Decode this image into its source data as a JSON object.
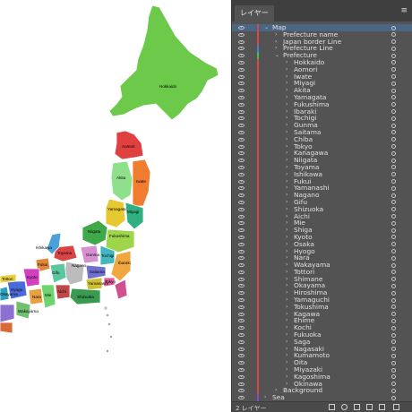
{
  "map": {
    "prefecture_labels": [
      {
        "text": "Hokkaido"
      },
      {
        "text": "Aomori"
      },
      {
        "text": "Akita"
      },
      {
        "text": "Iwate"
      },
      {
        "text": "Yamagata"
      },
      {
        "text": "Miyagi"
      },
      {
        "text": "Niigata"
      },
      {
        "text": "Fukushima"
      },
      {
        "text": "Ishikawa"
      },
      {
        "text": "Toyama"
      },
      {
        "text": "Gunma"
      },
      {
        "text": "Tochigi"
      },
      {
        "text": "Ibaraki"
      },
      {
        "text": "Saitama"
      },
      {
        "text": "Nagano"
      },
      {
        "text": "Yamanashi"
      },
      {
        "text": "Tokyo"
      },
      {
        "text": "Fukui"
      },
      {
        "text": "Gifu"
      },
      {
        "text": "Shizuoka"
      },
      {
        "text": "Aichi"
      },
      {
        "text": "Kyoto"
      },
      {
        "text": "Hyogo"
      },
      {
        "text": "Mie"
      },
      {
        "text": "Nara"
      },
      {
        "text": "Okayama"
      },
      {
        "text": "Tottori"
      },
      {
        "text": "Wakayama"
      }
    ]
  },
  "layers_panel": {
    "tab_label": "レイヤー",
    "menu_icon": "hamburger-menu-icon",
    "colors": {
      "red": "#d14b4b",
      "blue": "#4a7fd4",
      "green": "#3fbf4f",
      "purple": "#8050c8"
    },
    "rows": [
      {
        "name": "Map",
        "indent": 0,
        "expanded": true,
        "selected": true,
        "color": "red"
      },
      {
        "name": "Prefecture name",
        "indent": 1,
        "expanded": false,
        "color": "red"
      },
      {
        "name": "Japan border Line",
        "indent": 1,
        "expanded": false,
        "color": "red"
      },
      {
        "name": "Prefecture Line",
        "indent": 1,
        "expanded": false,
        "color": "blue"
      },
      {
        "name": "Prefecture",
        "indent": 1,
        "expanded": true,
        "color": "green"
      },
      {
        "name": "Hokkaido",
        "indent": 2,
        "expanded": false,
        "color": "red"
      },
      {
        "name": "Aomori",
        "indent": 2,
        "expanded": false,
        "color": "red"
      },
      {
        "name": "Iwate",
        "indent": 2,
        "expanded": false,
        "color": "red"
      },
      {
        "name": "Miyagi",
        "indent": 2,
        "expanded": false,
        "color": "red"
      },
      {
        "name": "Akita",
        "indent": 2,
        "expanded": false,
        "color": "red"
      },
      {
        "name": "Yamagata",
        "indent": 2,
        "expanded": false,
        "color": "red"
      },
      {
        "name": "Fukushima",
        "indent": 2,
        "expanded": false,
        "color": "red"
      },
      {
        "name": "Ibaraki",
        "indent": 2,
        "expanded": false,
        "color": "red"
      },
      {
        "name": "Tochigi",
        "indent": 2,
        "expanded": false,
        "color": "red"
      },
      {
        "name": "Gunma",
        "indent": 2,
        "expanded": false,
        "color": "red"
      },
      {
        "name": "Saitama",
        "indent": 2,
        "expanded": false,
        "color": "red"
      },
      {
        "name": "Chiba",
        "indent": 2,
        "expanded": false,
        "color": "red"
      },
      {
        "name": "Tokyo",
        "indent": 2,
        "expanded": false,
        "color": "red"
      },
      {
        "name": "Kanagawa",
        "indent": 2,
        "expanded": false,
        "color": "red"
      },
      {
        "name": "Niigata",
        "indent": 2,
        "expanded": false,
        "color": "red"
      },
      {
        "name": "Toyama",
        "indent": 2,
        "expanded": false,
        "color": "red"
      },
      {
        "name": "Ishikawa",
        "indent": 2,
        "expanded": false,
        "color": "red"
      },
      {
        "name": "Fukui",
        "indent": 2,
        "expanded": false,
        "color": "red"
      },
      {
        "name": "Yamanashi",
        "indent": 2,
        "expanded": false,
        "color": "red"
      },
      {
        "name": "Nagano",
        "indent": 2,
        "expanded": false,
        "color": "red"
      },
      {
        "name": "Gifu",
        "indent": 2,
        "expanded": false,
        "color": "red"
      },
      {
        "name": "Shizuoka",
        "indent": 2,
        "expanded": false,
        "color": "red"
      },
      {
        "name": "Aichi",
        "indent": 2,
        "expanded": false,
        "color": "red"
      },
      {
        "name": "Mie",
        "indent": 2,
        "expanded": false,
        "color": "red"
      },
      {
        "name": "Shiga",
        "indent": 2,
        "expanded": false,
        "color": "red"
      },
      {
        "name": "Kyoto",
        "indent": 2,
        "expanded": false,
        "color": "red"
      },
      {
        "name": "Osaka",
        "indent": 2,
        "expanded": false,
        "color": "red"
      },
      {
        "name": "Hyogo",
        "indent": 2,
        "expanded": false,
        "color": "red"
      },
      {
        "name": "Nara",
        "indent": 2,
        "expanded": false,
        "color": "red"
      },
      {
        "name": "Wakayama",
        "indent": 2,
        "expanded": false,
        "color": "red"
      },
      {
        "name": "Tottori",
        "indent": 2,
        "expanded": false,
        "color": "red"
      },
      {
        "name": "Shimane",
        "indent": 2,
        "expanded": false,
        "color": "red"
      },
      {
        "name": "Okayama",
        "indent": 2,
        "expanded": false,
        "color": "red"
      },
      {
        "name": "Hiroshima",
        "indent": 2,
        "expanded": false,
        "color": "red"
      },
      {
        "name": "Yamaguchi",
        "indent": 2,
        "expanded": false,
        "color": "red"
      },
      {
        "name": "Tokushima",
        "indent": 2,
        "expanded": false,
        "color": "red"
      },
      {
        "name": "Kagawa",
        "indent": 2,
        "expanded": false,
        "color": "red"
      },
      {
        "name": "Ehime",
        "indent": 2,
        "expanded": false,
        "color": "red"
      },
      {
        "name": "Kochi",
        "indent": 2,
        "expanded": false,
        "color": "red"
      },
      {
        "name": "Fukuoka",
        "indent": 2,
        "expanded": false,
        "color": "red"
      },
      {
        "name": "Saga",
        "indent": 2,
        "expanded": false,
        "color": "red"
      },
      {
        "name": "Nagasaki",
        "indent": 2,
        "expanded": false,
        "color": "red"
      },
      {
        "name": "Kumamoto",
        "indent": 2,
        "expanded": false,
        "color": "red"
      },
      {
        "name": "Oita",
        "indent": 2,
        "expanded": false,
        "color": "red"
      },
      {
        "name": "Miyazaki",
        "indent": 2,
        "expanded": false,
        "color": "red"
      },
      {
        "name": "Kagoshima",
        "indent": 2,
        "expanded": false,
        "color": "red"
      },
      {
        "name": "Okinawa",
        "indent": 2,
        "expanded": false,
        "color": "red"
      },
      {
        "name": "Background",
        "indent": 1,
        "expanded": false,
        "color": "red"
      },
      {
        "name": "Sea",
        "indent": 0,
        "expanded": false,
        "color": "purple"
      }
    ],
    "footer": {
      "layer_count": "2 レイヤー",
      "icons": [
        "export-icon",
        "search-icon",
        "clipping-mask-icon",
        "new-sublayer-icon",
        "new-layer-icon",
        "trash-icon"
      ]
    }
  }
}
